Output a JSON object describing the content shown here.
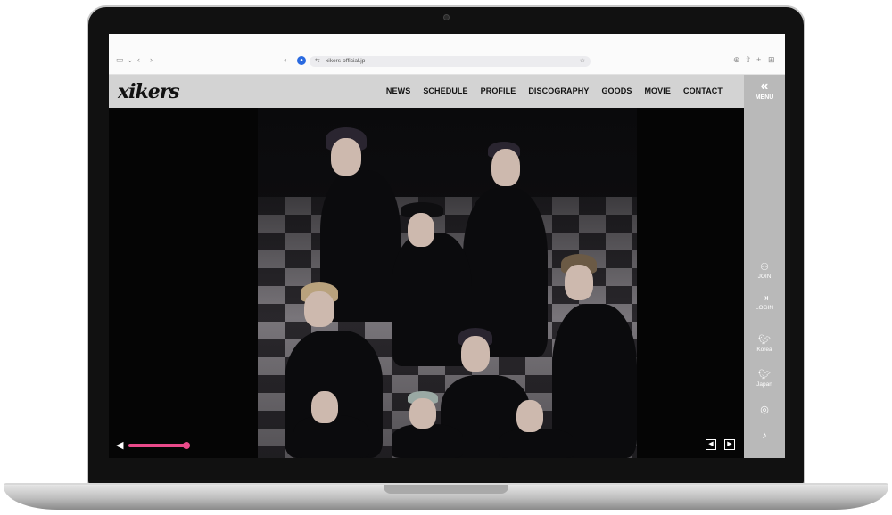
{
  "browser": {
    "url": "xikers-official.jp"
  },
  "site": {
    "logo": "xikers",
    "nav": [
      "NEWS",
      "SCHEDULE",
      "PROFILE",
      "DISCOGRAPHY",
      "GOODS",
      "MOVIE",
      "CONTACT"
    ]
  },
  "rail": {
    "menu_label": "MENU",
    "join_label": "JOIN",
    "login_label": "LOGIN",
    "twitter_korea_label": "Korea",
    "twitter_japan_label": "Japan"
  },
  "player": {
    "volume_level": 1.0
  },
  "colors": {
    "accent": "#e94a8a",
    "rail": "#b9b9b9",
    "header": "#d3d3d3"
  },
  "icons": {
    "menu": "double-chevron-left-icon",
    "join": "add-user-icon",
    "login": "login-icon",
    "twitter": "twitter-icon",
    "instagram": "instagram-icon",
    "tiktok": "tiktok-icon",
    "volume": "speaker-icon",
    "prev": "chevron-left-icon",
    "next": "chevron-right-icon"
  }
}
